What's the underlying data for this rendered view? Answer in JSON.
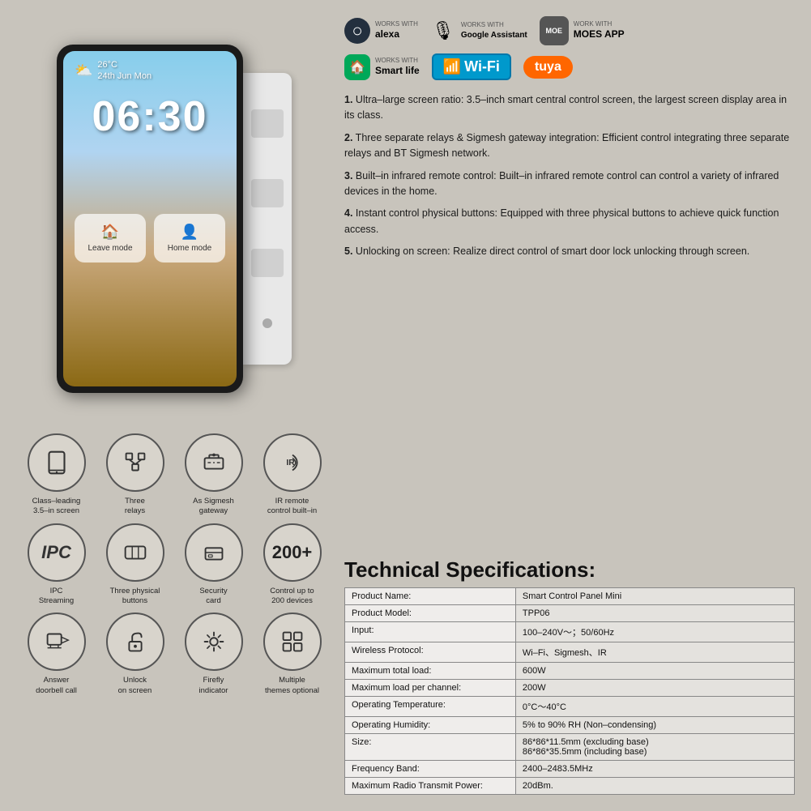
{
  "brands": [
    {
      "id": "alexa",
      "works_with": "WORKS WITH",
      "name": "alexa"
    },
    {
      "id": "google",
      "works_with": "Works with",
      "name": "Google Assistant"
    },
    {
      "id": "moes",
      "works_with": "WORK WITH",
      "name": "MOES APP"
    },
    {
      "id": "smartlife",
      "works_with": "WORKS WITH",
      "name": "Smart life"
    },
    {
      "id": "wifi",
      "label": "Wi-Fi"
    },
    {
      "id": "tuya",
      "label": "tuya"
    }
  ],
  "features": [
    {
      "id": "screen",
      "icon_type": "tablet",
      "label": "Class–leading\n3.5–in screen"
    },
    {
      "id": "relays",
      "icon_type": "relays",
      "label": "Three\nrelays"
    },
    {
      "id": "sigmesh",
      "icon_type": "gateway",
      "label": "As Sigmesh\ngateway"
    },
    {
      "id": "ir",
      "icon_type": "ir",
      "label": "IR remote\ncontrol built–in"
    },
    {
      "id": "ipc",
      "icon_type": "ipc",
      "label": "IPC\nStreaming"
    },
    {
      "id": "buttons",
      "icon_type": "buttons",
      "label": "Three physical\nbuttons"
    },
    {
      "id": "security",
      "icon_type": "security",
      "label": "Security\ncard"
    },
    {
      "id": "control200",
      "icon_type": "200plus",
      "label": "Control up to\n200 devices"
    },
    {
      "id": "doorbell",
      "icon_type": "doorbell",
      "label": "Answer\ndoorbell call"
    },
    {
      "id": "unlock",
      "icon_type": "unlock",
      "label": "Unlock\non screen"
    },
    {
      "id": "firefly",
      "icon_type": "firefly",
      "label": "Firefly\nindicator"
    },
    {
      "id": "themes",
      "icon_type": "themes",
      "label": "Multiple\nthemes optional"
    }
  ],
  "descriptions": [
    {
      "num": "1",
      "text": "Ultra–large screen ratio: 3.5–inch smart central control screen, the largest screen display area in its class."
    },
    {
      "num": "2",
      "text": "Three separate relays & Sigmesh gateway integration: Efficient control integrating three separate relays and BT Sigmesh network."
    },
    {
      "num": "3",
      "text": "Built–in infrared remote control: Built–in infrared remote control can control a variety of infrared devices in the home."
    },
    {
      "num": "4",
      "text": "Instant control physical buttons: Equipped with three physical buttons to achieve quick function access."
    },
    {
      "num": "5",
      "text": "Unlocking on screen: Realize direct control of smart door lock unlocking through screen."
    }
  ],
  "tech_specs": {
    "title": "Technical Specifications:",
    "rows": [
      {
        "label": "Product Name:",
        "value": "Smart Control Panel Mini"
      },
      {
        "label": "Product Model:",
        "value": "TPP06"
      },
      {
        "label": "Input:",
        "value": "100–240V～；50/60Hz"
      },
      {
        "label": "Wireless Protocol:",
        "value": "Wi–Fi、Sigmesh、IR"
      },
      {
        "label": "Maximum total load:",
        "value": "600W"
      },
      {
        "label": "Maximum load per channel:",
        "value": "200W"
      },
      {
        "label": "Operating Temperature:",
        "value": "0°C～40°C"
      },
      {
        "label": "Operating Humidity:",
        "value": "5% to 90% RH (Non–condensing)"
      },
      {
        "label": "Size:",
        "value": "86*86*11.5mm (excluding base)\n86*86*35.5mm (including base)"
      },
      {
        "label": "Frequency Band:",
        "value": "2400–2483.5MHz"
      },
      {
        "label": "Maximum Radio Transmit Power:",
        "value": "20dBm."
      }
    ]
  },
  "device": {
    "clock": "06:30",
    "temp": "26°C",
    "date": "24th Jun  Mon",
    "leave_mode": "Leave mode",
    "home_mode": "Home mode"
  }
}
